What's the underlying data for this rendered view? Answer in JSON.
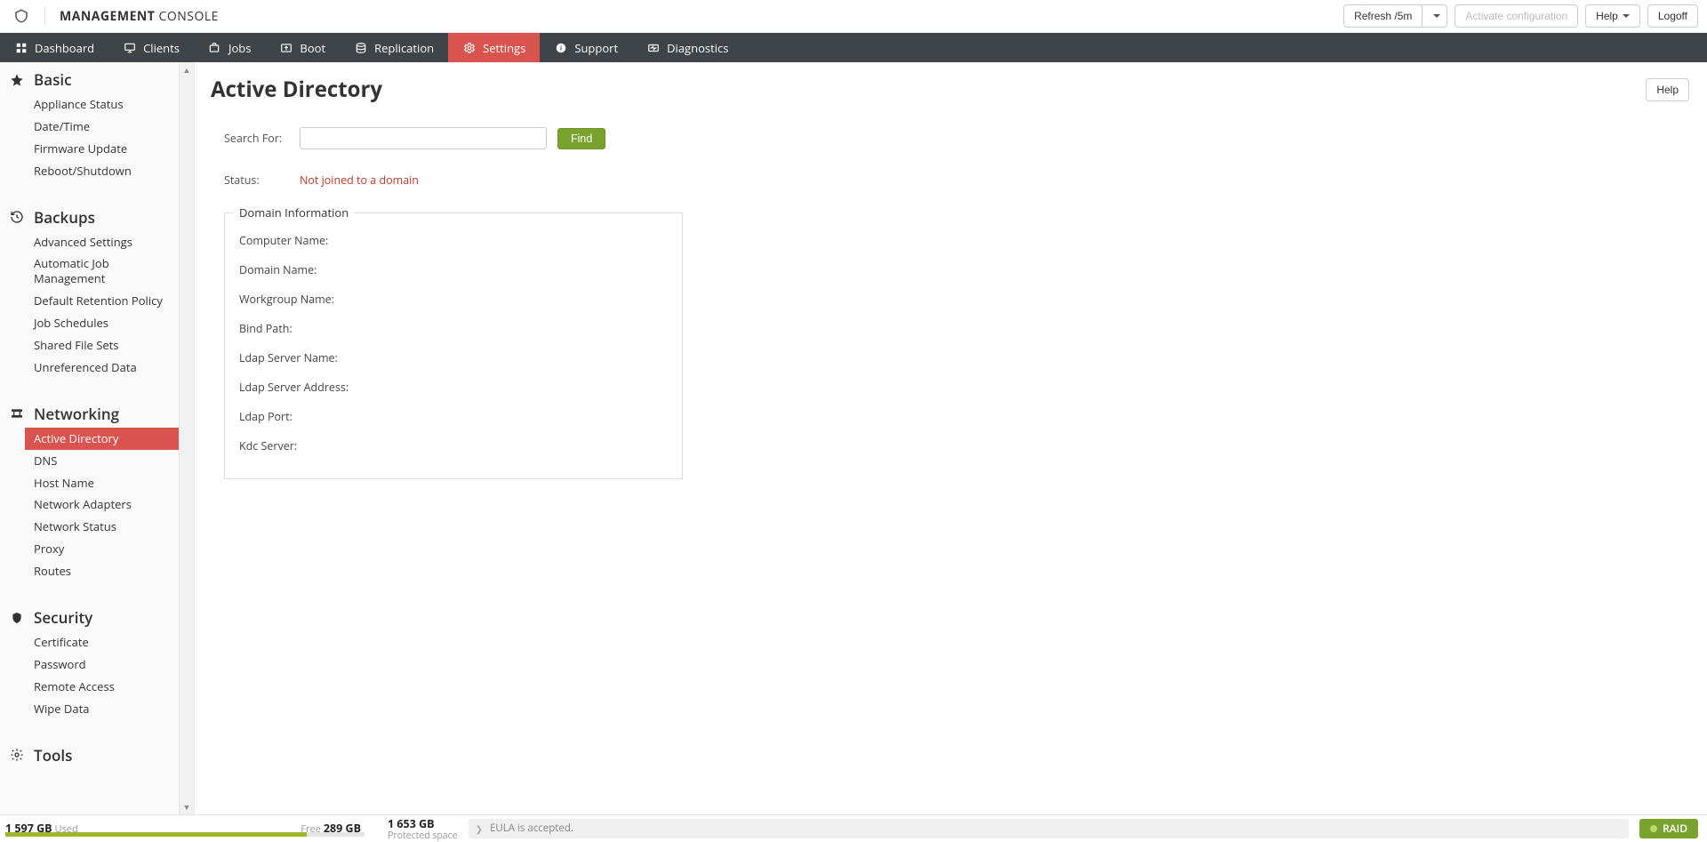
{
  "header": {
    "brand_main": "MANAGEMENT",
    "brand_sub": " CONSOLE",
    "refresh_label": "Refresh /5m",
    "activate_label": "Activate configuration",
    "help_label": "Help",
    "logoff_label": "Logoff"
  },
  "nav": {
    "items": [
      {
        "label": "Dashboard"
      },
      {
        "label": "Clients"
      },
      {
        "label": "Jobs"
      },
      {
        "label": "Boot"
      },
      {
        "label": "Replication"
      },
      {
        "label": "Settings"
      },
      {
        "label": "Support"
      },
      {
        "label": "Diagnostics"
      }
    ]
  },
  "sidebar": {
    "sections": [
      {
        "title": "Basic",
        "items": [
          "Appliance Status",
          "Date/Time",
          "Firmware Update",
          "Reboot/Shutdown"
        ]
      },
      {
        "title": "Backups",
        "items": [
          "Advanced Settings",
          "Automatic Job Management",
          "Default Retention Policy",
          "Job Schedules",
          "Shared File Sets",
          "Unreferenced Data"
        ]
      },
      {
        "title": "Networking",
        "items": [
          "Active Directory",
          "DNS",
          "Host Name",
          "Network Adapters",
          "Network Status",
          "Proxy",
          "Routes"
        ]
      },
      {
        "title": "Security",
        "items": [
          "Certificate",
          "Password",
          "Remote Access",
          "Wipe Data"
        ]
      },
      {
        "title": "Tools",
        "items": []
      }
    ]
  },
  "page": {
    "title": "Active Directory",
    "help_label": "Help",
    "search_label": "Search For:",
    "find_label": "Find",
    "status_label": "Status:",
    "status_value": "Not joined to a domain",
    "legend": "Domain Information",
    "info": {
      "computer": "Computer Name:",
      "domain": "Domain Name:",
      "workgroup": "Workgroup Name:",
      "bind": "Bind Path:",
      "ldapname": "Ldap Server Name:",
      "ldapaddr": "Ldap Server Address:",
      "ldapport": "Ldap Port:",
      "kdc": "Kdc Server:"
    }
  },
  "footer": {
    "used_value": "1 597 GB",
    "used_label": "Used",
    "free_label": "Free",
    "free_value": "289 GB",
    "prot_value": "1 653 GB",
    "prot_label": "Protected space",
    "eula_text": "EULA is accepted.",
    "raid_label": "RAID"
  }
}
